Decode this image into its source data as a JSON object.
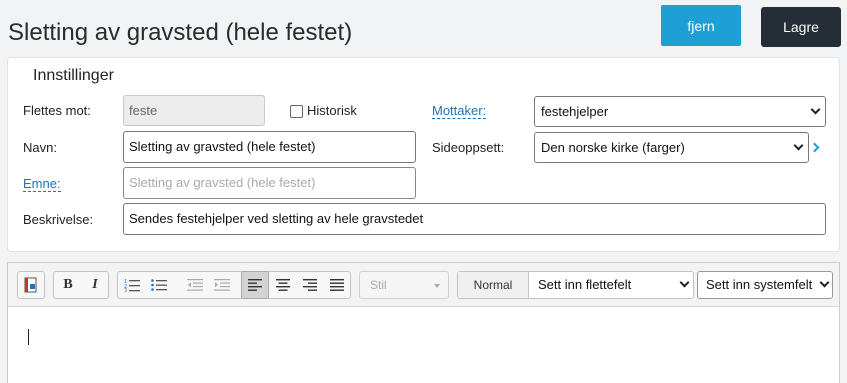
{
  "header": {
    "title": "Sletting av gravsted (hele festet)",
    "remove_label": "fjern",
    "save_label": "Lagre"
  },
  "settings": {
    "title": "Innstillinger",
    "merge_label": "Flettes mot:",
    "merge_value": "feste",
    "historic_label": "Historisk",
    "historic_checked": false,
    "recipient_label": "Mottaker:",
    "recipient_value": "festehjelper",
    "name_label": "Navn:",
    "name_value": "Sletting av gravsted (hele festet)",
    "layout_label": "Sideoppsett:",
    "layout_value": "Den norske kirke (farger)",
    "subject_label": "Emne:",
    "subject_placeholder": "Sletting av gravsted (hele festet)",
    "description_label": "Beskrivelse:",
    "description_value": "Sendes festehjelper ved sletting av hele gravstedet"
  },
  "toolbar": {
    "bold": "B",
    "italic": "I",
    "style_placeholder": "Stil",
    "format_label": "Normal",
    "merge_field_select": "Sett inn flettefelt",
    "system_field_select": "Sett inn systemfelt"
  },
  "colors": {
    "primary": "#1e9fd6",
    "dark": "#252d36",
    "link": "#1c74b0"
  }
}
